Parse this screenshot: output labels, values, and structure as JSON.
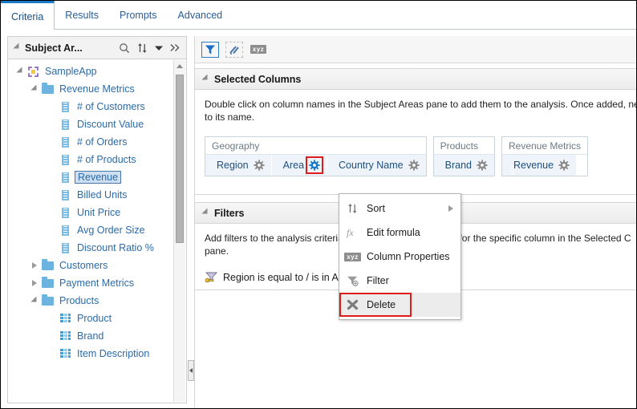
{
  "tabs": [
    {
      "label": "Criteria",
      "active": true
    },
    {
      "label": "Results",
      "active": false
    },
    {
      "label": "Prompts",
      "active": false
    },
    {
      "label": "Advanced",
      "active": false
    }
  ],
  "sidebar": {
    "title": "Subject Ar...",
    "icons": [
      "search-icon",
      "sort-icon",
      "chevron-down-icon",
      "expand-right-icon"
    ],
    "tree": [
      {
        "label": "SampleApp",
        "level": 1,
        "icon": "app-icon",
        "twist": "down",
        "selected": false
      },
      {
        "label": "Revenue Metrics",
        "level": 2,
        "icon": "folder-icon",
        "twist": "down",
        "selected": false
      },
      {
        "label": "# of Customers",
        "level": 3,
        "icon": "measure-icon",
        "twist": "none",
        "selected": false
      },
      {
        "label": "Discount Value",
        "level": 3,
        "icon": "measure-icon",
        "twist": "none",
        "selected": false
      },
      {
        "label": "# of Orders",
        "level": 3,
        "icon": "measure-icon",
        "twist": "none",
        "selected": false
      },
      {
        "label": "# of Products",
        "level": 3,
        "icon": "measure-icon",
        "twist": "none",
        "selected": false
      },
      {
        "label": "Revenue",
        "level": 3,
        "icon": "measure-icon",
        "twist": "none",
        "selected": true
      },
      {
        "label": "Billed Units",
        "level": 3,
        "icon": "measure-icon",
        "twist": "none",
        "selected": false
      },
      {
        "label": "Unit Price",
        "level": 3,
        "icon": "measure-icon",
        "twist": "none",
        "selected": false
      },
      {
        "label": "Avg Order Size",
        "level": 3,
        "icon": "measure-icon",
        "twist": "none",
        "selected": false
      },
      {
        "label": "Discount Ratio %",
        "level": 3,
        "icon": "measure-icon",
        "twist": "none",
        "selected": false
      },
      {
        "label": "Customers",
        "level": 2,
        "icon": "folder-icon",
        "twist": "right",
        "selected": false
      },
      {
        "label": "Payment Metrics",
        "level": 2,
        "icon": "folder-icon",
        "twist": "right",
        "selected": false
      },
      {
        "label": "Products",
        "level": 2,
        "icon": "folder-icon",
        "twist": "down",
        "selected": false
      },
      {
        "label": "Product",
        "level": 3,
        "icon": "attribute-icon",
        "twist": "none",
        "selected": false
      },
      {
        "label": "Brand",
        "level": 3,
        "icon": "attribute-icon",
        "twist": "none",
        "selected": false
      },
      {
        "label": "Item Description",
        "level": 3,
        "icon": "attribute-icon",
        "twist": "none",
        "selected": false
      }
    ]
  },
  "toolbar": {
    "buttons": [
      {
        "name": "filter-icon",
        "selected": true
      },
      {
        "name": "measure-edit-icon",
        "selected": false
      },
      {
        "name": "column-properties-xyz-icon",
        "selected": false,
        "text": "xyz"
      }
    ]
  },
  "selected_columns": {
    "title": "Selected Columns",
    "hint": "Double click on column names in the Subject Areas pane to add them to the analysis. Once added, next to its name.",
    "groups": [
      {
        "name": "Geography",
        "columns": [
          {
            "label": "Region",
            "icon": "attribute-icon",
            "gear_highlighted": false
          },
          {
            "label": "Area",
            "icon": "attribute-icon",
            "gear_highlighted": true
          },
          {
            "label": "Country Name",
            "icon": "attribute-icon",
            "gear_highlighted": false
          }
        ]
      },
      {
        "name": "Products",
        "columns": [
          {
            "label": "Brand",
            "icon": "attribute-icon",
            "gear_highlighted": false
          }
        ]
      },
      {
        "name": "Revenue Metrics",
        "columns": [
          {
            "label": "Revenue",
            "icon": "measure-icon",
            "gear_highlighted": false
          }
        ]
      }
    ]
  },
  "context_menu": {
    "items": [
      {
        "label": "Sort",
        "icon": "sort-icon",
        "submenu": true,
        "highlighted": false,
        "boxed": false
      },
      {
        "label": "Edit formula",
        "icon": "fx-formula-icon",
        "submenu": false,
        "highlighted": false,
        "boxed": false
      },
      {
        "label": "Column Properties",
        "icon": "xyz-properties-icon",
        "submenu": false,
        "highlighted": false,
        "boxed": false
      },
      {
        "label": "Filter",
        "icon": "filter-add-icon",
        "submenu": false,
        "highlighted": false,
        "boxed": false
      },
      {
        "label": "Delete",
        "icon": "delete-x-icon",
        "submenu": false,
        "highlighted": true,
        "boxed": true
      }
    ]
  },
  "filters": {
    "title": "Filters",
    "hint": "Add filters to the analysis criteria by clicking on Filter option for the specific column in the Selected C pane.",
    "items": [
      {
        "text": "Region is equal to / is in  AMERICAS",
        "icon": "filter-key-icon"
      }
    ]
  },
  "colors": {
    "accent": "#1a7ac7",
    "link": "#2a6ba8",
    "highlight_box": "#e01b1b",
    "selection_bg": "#cddff0",
    "pill_bg": "#eef4fa"
  }
}
